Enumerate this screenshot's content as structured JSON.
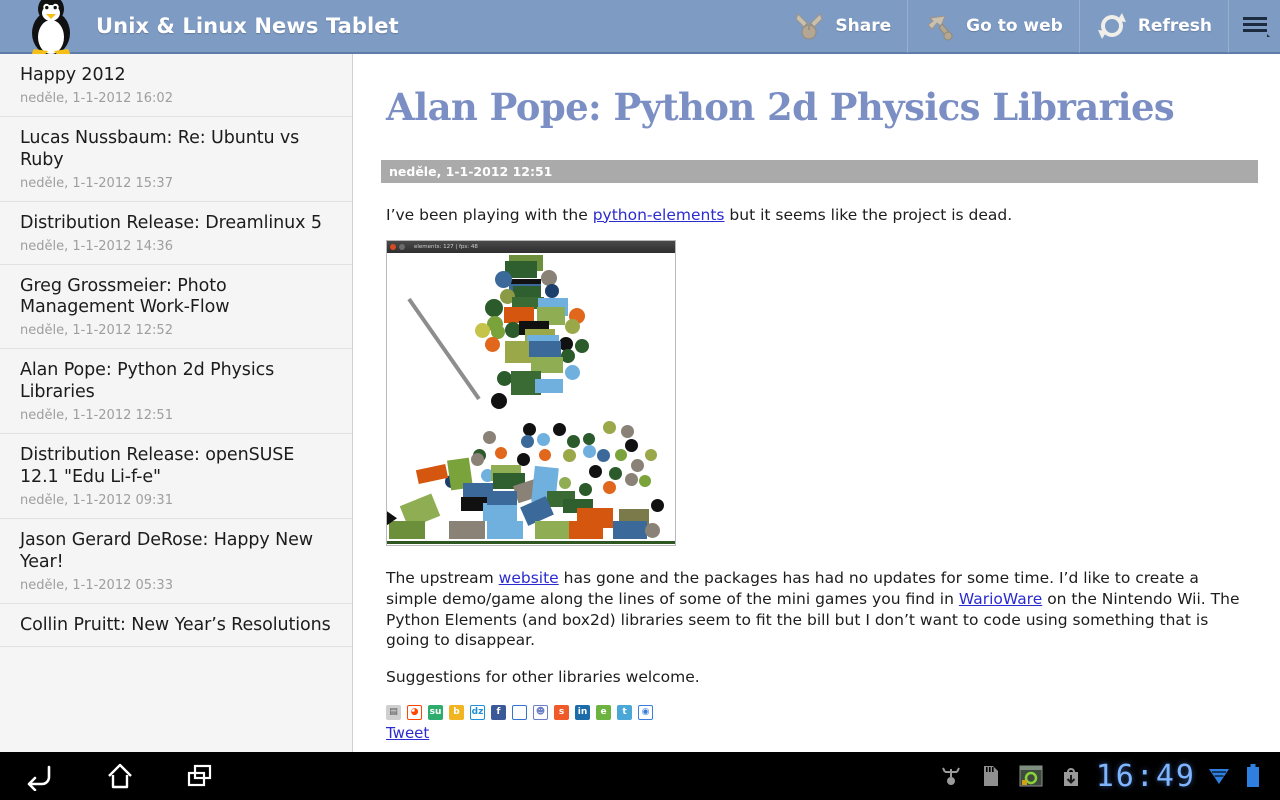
{
  "actionbar": {
    "logo_icon": "tux-penguin-logo",
    "title": "Unix & Linux News Tablet",
    "items": [
      {
        "label": "Share",
        "icon": "share-icon"
      },
      {
        "label": "Go to web",
        "icon": "go-to-web-icon"
      },
      {
        "label": "Refresh",
        "icon": "refresh-icon"
      }
    ],
    "overflow_icon": "overflow-menu-icon",
    "bg_color": "#7e9bc4"
  },
  "sidebar": {
    "items": [
      {
        "title": "Happy 2012",
        "date": "neděle, 1-1-2012 16:02"
      },
      {
        "title": "Lucas Nussbaum: Re: Ubuntu vs Ruby",
        "date": "neděle, 1-1-2012 15:37"
      },
      {
        "title": "Distribution Release: Dreamlinux 5",
        "date": "neděle, 1-1-2012 14:36"
      },
      {
        "title": "Greg Grossmeier: Photo Management Work-Flow",
        "date": "neděle, 1-1-2012 12:52"
      },
      {
        "title": "Alan Pope: Python 2d Physics Libraries",
        "date": "neděle, 1-1-2012 12:51"
      },
      {
        "title": "Distribution Release: openSUSE 12.1 \"Edu Li-f-e\"",
        "date": "neděle, 1-1-2012 09:31"
      },
      {
        "title": "Jason Gerard DeRose: Happy New Year!",
        "date": "neděle, 1-1-2012 05:33"
      },
      {
        "title": "Collin Pruitt: New Year’s Resolutions",
        "date": ""
      }
    ]
  },
  "article": {
    "title": "Alan Pope: Python 2d Physics Libraries",
    "title_color": "#7b8fc4",
    "date": "neděle, 1-1-2012 12:51",
    "p1_before": "I’ve been playing with the ",
    "p1_link": "python-elements",
    "p1_after": " but it seems like the project is dead.",
    "screenshot": {
      "window_title": "elements: 127 | fps: 48",
      "alt": "python-elements physics demo with falling boxes and circles"
    },
    "p2_a": "The upstream ",
    "p2_link1": "website",
    "p2_b": " has gone and the packages has had no updates for some time. I’d like to create a simple demo/game along the lines of some of the mini games you find in ",
    "p2_link2": "WarioWare",
    "p2_c": " on the Nintendo Wii. The Python Elements (and box2d) libraries seem to fit the bill but I don’t want to code using something that is going to disappear.",
    "p3": "Suggestions for other libraries welcome.",
    "tweet_label": "Tweet",
    "social_icons": [
      {
        "name": "newsvine-icon",
        "glyph": "▤",
        "bg": "#cfcfcf",
        "fg": "#555555"
      },
      {
        "name": "reddit-icon",
        "glyph": "◕",
        "bg": "#ffffff",
        "fg": "#ff4500"
      },
      {
        "name": "stumbleupon-icon",
        "glyph": "su",
        "bg": "#2eac6d",
        "fg": "#ffffff"
      },
      {
        "name": "bebo-icon",
        "glyph": "b",
        "bg": "#f0b521",
        "fg": "#ffffff"
      },
      {
        "name": "designfloat-icon",
        "glyph": "dz",
        "bg": "#ffffff",
        "fg": "#1f8fd6"
      },
      {
        "name": "facebook-icon",
        "glyph": "f",
        "bg": "#3b5998",
        "fg": "#ffffff"
      },
      {
        "name": "delicious-icon",
        "glyph": "",
        "bg": "#ffffff",
        "fg": "#3274d0"
      },
      {
        "name": "myspace-icon",
        "glyph": "☻",
        "bg": "#ffffff",
        "fg": "#6b7fc4"
      },
      {
        "name": "sphinn-icon",
        "glyph": "s",
        "bg": "#ef5a28",
        "fg": "#ffffff"
      },
      {
        "name": "linkedin-icon",
        "glyph": "in",
        "bg": "#1b6ca8",
        "fg": "#ffffff"
      },
      {
        "name": "technorati-icon",
        "glyph": "e",
        "bg": "#6cb33f",
        "fg": "#ffffff"
      },
      {
        "name": "twitter-icon",
        "glyph": "t",
        "bg": "#4aa8d8",
        "fg": "#ffffff"
      },
      {
        "name": "google-buzz-icon",
        "glyph": "◉",
        "bg": "#ffffff",
        "fg": "#3b7ddd"
      }
    ]
  },
  "navbar": {
    "back_icon": "back-icon",
    "home_icon": "home-icon",
    "recents_icon": "recent-apps-icon",
    "system_icons": [
      "usb-debug-icon",
      "sd-card-icon",
      "screenshot-icon",
      "download-icon"
    ],
    "clock": "16:49",
    "wifi_icon": "wifi-icon",
    "battery_icon": "battery-icon",
    "clock_color": "#7fb4ff"
  }
}
